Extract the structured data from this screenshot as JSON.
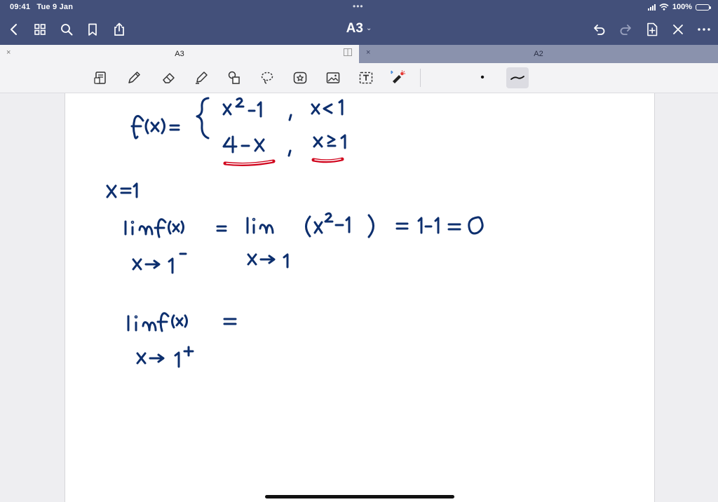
{
  "status_bar": {
    "time": "09:41",
    "date": "Tue 9 Jan",
    "battery": "100%",
    "dots": "•••"
  },
  "nav": {
    "document_title": "A3",
    "title_chevron": "⌄",
    "left_icons": [
      "back-icon",
      "grid-icon",
      "search-icon",
      "bookmark-icon",
      "share-icon"
    ],
    "right_icons": [
      "undo-icon",
      "redo-icon",
      "add-page-icon",
      "close-icon",
      "more-icon"
    ]
  },
  "tabs": [
    {
      "label": "A3",
      "close": "×",
      "active": true
    },
    {
      "label": "A2",
      "close": "×",
      "active": false
    }
  ],
  "toolbar": {
    "tools": [
      "reader-icon",
      "pen-icon",
      "eraser-icon",
      "highlighter-icon",
      "shapes-icon",
      "lasso-icon",
      "sticker-icon",
      "image-icon",
      "text-icon",
      "laser-pointer-icon"
    ],
    "pen_dot_label": "•",
    "ink_color": "#0d2f6e",
    "highlight_color": "#d0021b"
  },
  "handwriting": {
    "function_def": "f(x) = { x² − 1 , x < 1 ; 4 − x , x ≥ 1",
    "point": "x = 1",
    "left_limit": "lim f(x) = lim (x² − 1) = 1 − 1 = 0 ; x → 1⁻ ; x → 1",
    "right_limit": "lim f(x) = ; x → 1⁺"
  }
}
